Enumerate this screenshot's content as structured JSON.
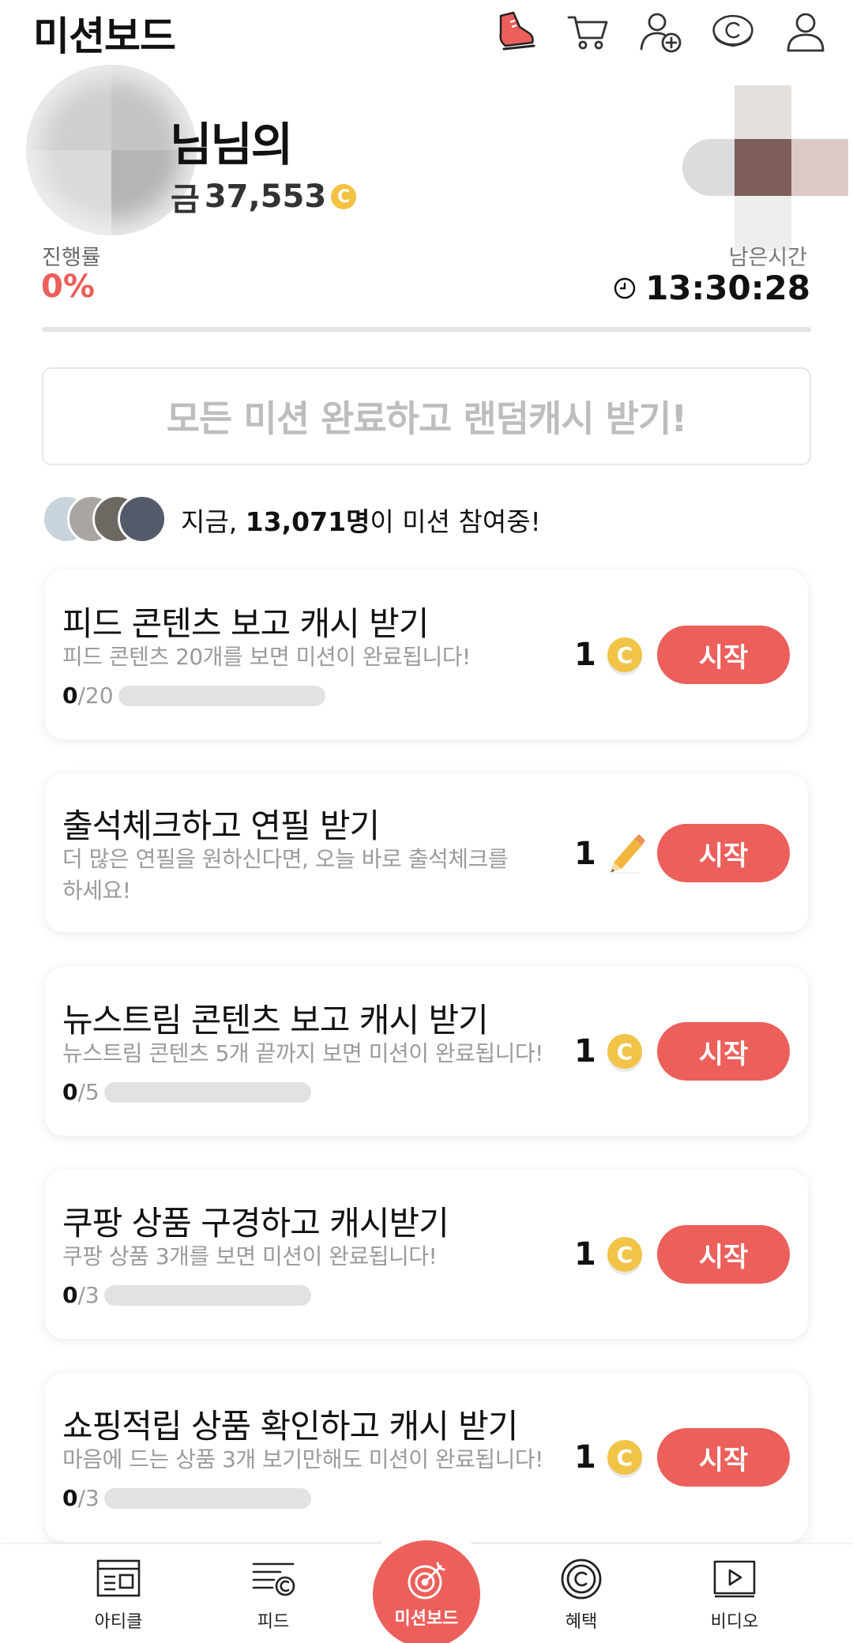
{
  "header": {
    "title": "미션보드",
    "icons": [
      "shoe-icon",
      "cart-icon",
      "add-friend-icon",
      "cash-coin-icon",
      "profile-icon"
    ]
  },
  "profile": {
    "name_suffix": "님님의",
    "cash_prefix": "금",
    "cash_amount": "37,553",
    "coin_symbol": "C"
  },
  "progress": {
    "label": "진행률",
    "value": "0%",
    "fraction": 0
  },
  "remaining": {
    "label": "남은시간",
    "time": "13:30:28"
  },
  "complete_banner": {
    "text": "모든 미션 완료하고 랜덤캐시 받기!"
  },
  "participants": {
    "prefix": "지금, ",
    "count": "13,071명",
    "suffix": "이 미션 참여중!"
  },
  "missions": [
    {
      "title": "피드 콘텐츠 보고 캐시 받기",
      "description": "피드 콘텐츠 20개를 보면 미션이 완료됩니다!",
      "done": "0",
      "total": "/20",
      "fraction": 0,
      "reward": "1",
      "reward_type": "cash",
      "button": "시작"
    },
    {
      "title": "출석체크하고 연필 받기",
      "description": "더 많은 연필을 원하신다면, 오늘 바로 출석체크를 하세요!",
      "reward": "1",
      "reward_type": "pencil",
      "button": "시작"
    },
    {
      "title": "뉴스트림 콘텐츠 보고 캐시 받기",
      "description": "뉴스트림 콘텐츠 5개 끝까지 보면 미션이 완료됩니다!",
      "done": "0",
      "total": "/5",
      "fraction": 0,
      "reward": "1",
      "reward_type": "cash",
      "button": "시작"
    },
    {
      "title": "쿠팡 상품 구경하고 캐시받기",
      "description": "쿠팡 상품 3개를 보면 미션이 완료됩니다!",
      "done": "0",
      "total": "/3",
      "fraction": 0,
      "reward": "1",
      "reward_type": "cash",
      "button": "시작"
    },
    {
      "title": "쇼핑적립 상품 확인하고 캐시 받기",
      "description": "마음에 드는 상품 3개 보기만해도 미션이 완료됩니다!",
      "done": "0",
      "total": "/3",
      "fraction": 0,
      "reward": "1",
      "reward_type": "cash",
      "button": "시작"
    }
  ],
  "bottom_nav": {
    "items": [
      {
        "label": "아티클",
        "icon": "article-icon"
      },
      {
        "label": "피드",
        "icon": "feed-icon"
      },
      {
        "label": "미션보드",
        "icon": "target-icon",
        "active": true
      },
      {
        "label": "혜택",
        "icon": "benefit-coin-icon"
      },
      {
        "label": "비디오",
        "icon": "video-icon"
      }
    ]
  },
  "colors": {
    "accent": "#ec5f5a",
    "coin": "#f1c347",
    "muted_text": "#9b9b9b"
  }
}
